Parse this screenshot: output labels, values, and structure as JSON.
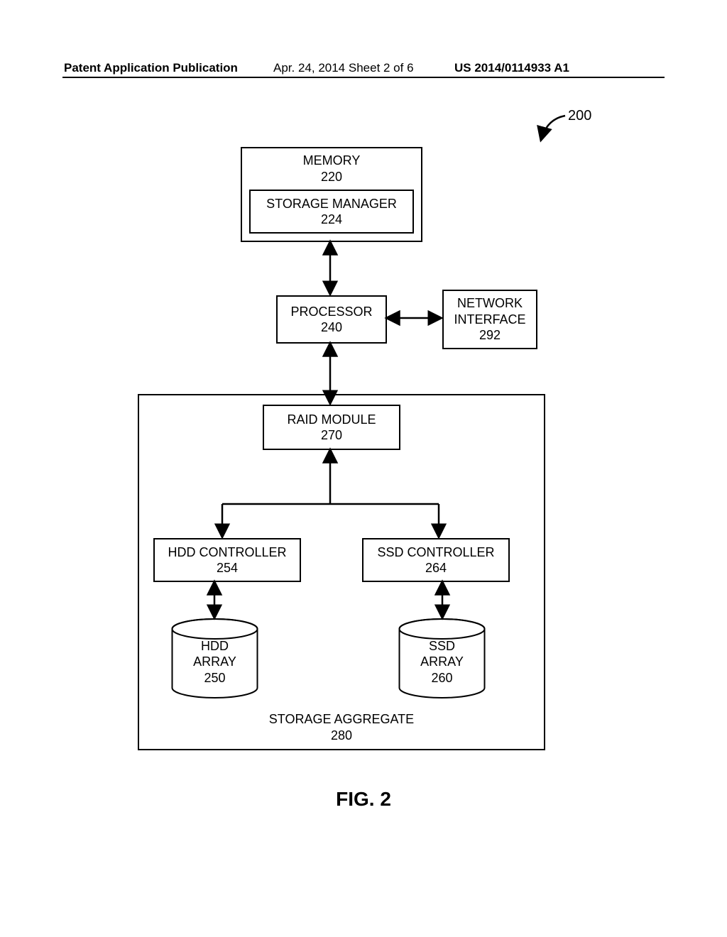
{
  "header": {
    "left": "Patent Application Publication",
    "mid": "Apr. 24, 2014  Sheet 2 of 6",
    "right": "US 2014/0114933 A1"
  },
  "figure_ref": "200",
  "memory": {
    "title": "MEMORY",
    "num": "220"
  },
  "storage_manager": {
    "title": "STORAGE MANAGER",
    "num": "224"
  },
  "processor": {
    "title": "PROCESSOR",
    "num": "240"
  },
  "network_interface": {
    "title1": "NETWORK",
    "title2": "INTERFACE",
    "num": "292"
  },
  "raid_module": {
    "title": "RAID MODULE",
    "num": "270"
  },
  "hdd_controller": {
    "title": "HDD CONTROLLER",
    "num": "254"
  },
  "ssd_controller": {
    "title": "SSD CONTROLLER",
    "num": "264"
  },
  "hdd_array": {
    "title1": "HDD",
    "title2": "ARRAY",
    "num": "250"
  },
  "ssd_array": {
    "title1": "SSD",
    "title2": "ARRAY",
    "num": "260"
  },
  "storage_aggregate": {
    "title": "STORAGE AGGREGATE",
    "num": "280"
  },
  "figure_caption": "FIG. 2"
}
